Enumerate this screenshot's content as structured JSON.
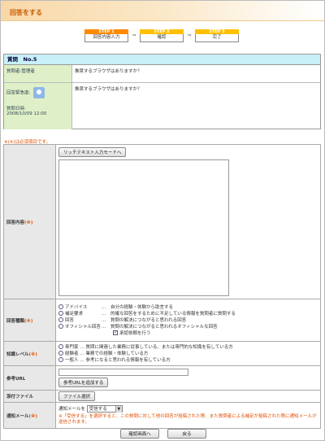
{
  "page": {
    "title": "回答をする"
  },
  "steps": [
    {
      "step": "STEP 1",
      "label": "回答内容入力"
    },
    {
      "step": "STEP 2",
      "label": "確認"
    },
    {
      "step": "STEP 3",
      "label": "完了"
    }
  ],
  "question": {
    "header": "質問　No.5",
    "asker_label": "質問者:管理者",
    "title": "推奨するブラウザはありますか？",
    "urgency_label": "回答緊急度:",
    "body": "推奨するブラウザはありますか？",
    "date_label": "質問日時:",
    "date": "2008/10/09 12:00"
  },
  "required_note": "※(※)は必須項目です。",
  "form": {
    "answer_label": "回答内容",
    "rich_text_button": "リッチテキスト入力モードへ",
    "type_label": "回答種類",
    "types": [
      {
        "name": "アドバイス",
        "desc": "自分の経験・体験から助言する"
      },
      {
        "name": "補足要求",
        "desc": "的確な回答をするために不足している情報を質問者に質問する"
      },
      {
        "name": "回答",
        "desc": "質問の解決につながると思われる回答"
      },
      {
        "name": "オフィシャル回答",
        "desc": "質問の解決につながると思われるオフィシャルな回答"
      }
    ],
    "confirm_check": "承認依頼を行う",
    "knowledge_label": "知識レベル",
    "levels": [
      {
        "name": "専門家",
        "desc": "質問に関連した業務に従事している、または専門的な知識を有している方"
      },
      {
        "name": "経験者",
        "desc": "業務での経験・体験している方"
      },
      {
        "name": "一般人",
        "desc": "参考になると思われる情報を有している方"
      }
    ],
    "url_label": "参考URL",
    "add_url_button": "参考URLを追加する",
    "attach_label": "添付ファイル",
    "file_button": "ファイル選択",
    "mail_label": "通知メール",
    "mail_prefix": "通知メールを",
    "mail_option": "受信する",
    "mail_note": "※「受信する」を選択すると、この質問に対して他の回答が投稿された際、また質問者による補足が投稿された際に通知メールが送信されます。"
  },
  "buttons": {
    "confirm": "確認画面へ",
    "back": "戻る"
  }
}
